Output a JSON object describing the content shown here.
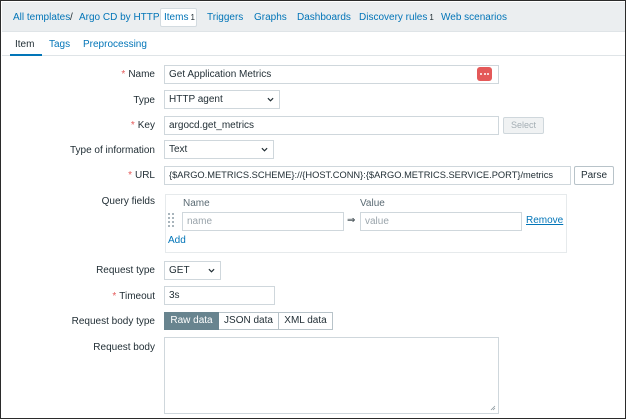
{
  "breadcrumb": {
    "all_templates": "All templates",
    "separator": "/",
    "template_name": "Argo CD by HTTP"
  },
  "nav_tabs": {
    "items_label": "Items",
    "items_count": "1",
    "triggers": "Triggers",
    "graphs": "Graphs",
    "dashboards": "Dashboards",
    "discovery_rules_label": "Discovery rules",
    "discovery_rules_count": "1",
    "web_scenarios": "Web scenarios"
  },
  "sub_tabs": {
    "item": "Item",
    "tags": "Tags",
    "preprocessing": "Preprocessing"
  },
  "form": {
    "required_mark": "*",
    "name_label": "Name",
    "name_value": "Get Application Metrics",
    "type_label": "Type",
    "type_value": "HTTP agent",
    "key_label": "Key",
    "key_value": "argocd.get_metrics",
    "select_button": "Select",
    "type_info_label": "Type of information",
    "type_info_value": "Text",
    "url_label": "URL",
    "url_value": "{$ARGO.METRICS.SCHEME}://{HOST.CONN}:{$ARGO.METRICS.SERVICE.PORT}/metrics",
    "parse_button": "Parse",
    "query_fields_label": "Query fields",
    "query_name_header": "Name",
    "query_value_header": "Value",
    "query_name_placeholder": "name",
    "query_value_placeholder": "value",
    "arrow": "⇒",
    "remove_link": "Remove",
    "add_link": "Add",
    "request_type_label": "Request type",
    "request_type_value": "GET",
    "timeout_label": "Timeout",
    "timeout_value": "3s",
    "request_body_type_label": "Request body type",
    "body_type_options": [
      "Raw data",
      "JSON data",
      "XML data"
    ],
    "body_type_selected": "Raw data",
    "request_body_label": "Request body",
    "request_body_value": ""
  },
  "colors": {
    "link": "#0275b8",
    "required": "#e45959",
    "segment_active": "#68848f",
    "nav_bg": "#ebeef0"
  },
  "icons": {
    "macro_button": "ellipsis-icon",
    "dropdown": "chevron-down-icon",
    "drag_handle": "drag-handle-icon",
    "resize": "resize-grip-icon"
  }
}
